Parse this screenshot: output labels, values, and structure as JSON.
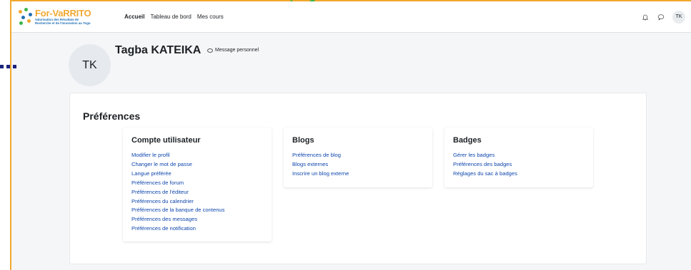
{
  "brand": {
    "title": "For-VaRRITO",
    "subtitle_line1": "Valorisation des Résultats de",
    "subtitle_line2": "Recherche et de l'Innovation au Togo"
  },
  "nav": {
    "links": [
      {
        "label": "Accueil",
        "active": true
      },
      {
        "label": "Tableau de bord",
        "active": false
      },
      {
        "label": "Mes cours",
        "active": false
      }
    ],
    "avatar_initials": "TK"
  },
  "profile": {
    "initials": "TK",
    "name": "Tagba KATEIKA",
    "message_label": "Message personnel"
  },
  "preferences": {
    "title": "Préférences",
    "sections": [
      {
        "heading": "Compte utilisateur",
        "links": [
          "Modifier le profil",
          "Changer le mot de passe",
          "Langue préférée",
          "Préférences de forum",
          "Préférences de l'éditeur",
          "Préférences du calendrier",
          "Préférences de la banque de contenus",
          "Préférences des messages",
          "Préférences de notification"
        ]
      },
      {
        "heading": "Blogs",
        "links": [
          "Préférences de blog",
          "Blogs externes",
          "Inscrire un blog externe"
        ]
      },
      {
        "heading": "Badges",
        "links": [
          "Gérer les badges",
          "Préférences des badges",
          "Réglages du sac à badges"
        ]
      }
    ]
  },
  "colors": {
    "brand_orange": "#f0a830",
    "link_blue": "#0f47ad",
    "brand_blue": "#1f6fb5"
  }
}
